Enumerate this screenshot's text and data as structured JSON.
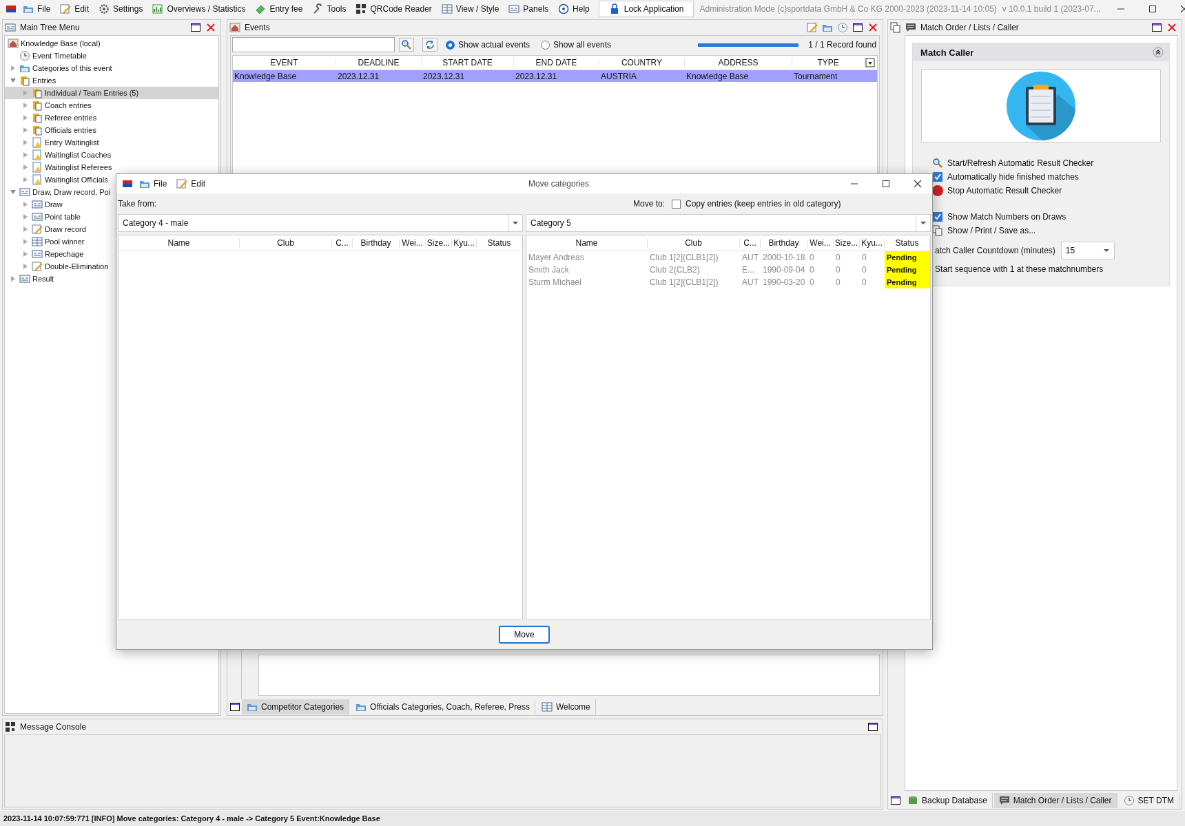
{
  "menubar": {
    "items": [
      {
        "label": "File"
      },
      {
        "label": "Edit"
      },
      {
        "label": "Settings"
      },
      {
        "label": "Overviews / Statistics"
      },
      {
        "label": "Entry fee"
      },
      {
        "label": "Tools"
      },
      {
        "label": "QRCode Reader"
      },
      {
        "label": "View / Style"
      },
      {
        "label": "Panels"
      },
      {
        "label": "Help"
      }
    ],
    "lock_button": "Lock Application",
    "mode_text": "Administration Mode (c)sportdata GmbH & Co KG 2000-2023 (2023-11-14 10:05)",
    "version_text": "v 10.0.1 build 1 (2023-07..."
  },
  "tree_panel": {
    "title": "Main Tree Menu",
    "items": [
      {
        "label": "Knowledge Base (local)",
        "selected": false,
        "children": [
          {
            "label": "Event Timetable",
            "selected": false
          },
          {
            "label": "Categories of this event",
            "expanded": false,
            "selected": false
          },
          {
            "label": "Entries",
            "expanded": true,
            "selected": false,
            "children": [
              {
                "label": "Individual / Team Entries (5)",
                "expanded": false,
                "selected": true
              },
              {
                "label": "Coach entries",
                "expanded": false,
                "selected": false
              },
              {
                "label": "Referee entries",
                "expanded": false,
                "selected": false
              },
              {
                "label": "Officials entries",
                "expanded": false,
                "selected": false
              },
              {
                "label": "Entry Waitinglist",
                "expanded": false,
                "selected": false
              },
              {
                "label": "Waitinglist Coaches",
                "expanded": false,
                "selected": false
              },
              {
                "label": "Waitinglist Referees",
                "expanded": false,
                "selected": false
              },
              {
                "label": "Waitinglist Officials",
                "expanded": false,
                "selected": false
              }
            ]
          },
          {
            "label": "Draw, Draw record, Poi",
            "expanded": true,
            "selected": false,
            "children": [
              {
                "label": "Draw",
                "expanded": false,
                "selected": false
              },
              {
                "label": "Point table",
                "expanded": false,
                "selected": false
              },
              {
                "label": "Draw record",
                "expanded": false,
                "selected": false
              },
              {
                "label": "Pool winner",
                "expanded": false,
                "selected": false
              },
              {
                "label": "Repechage",
                "expanded": false,
                "selected": false
              },
              {
                "label": "Double-Elimination",
                "expanded": false,
                "selected": false
              }
            ]
          },
          {
            "label": "Result",
            "expanded": false,
            "selected": false
          }
        ]
      }
    ]
  },
  "events_panel": {
    "title": "Events",
    "radios": [
      {
        "label": "Show actual events",
        "selected": true
      },
      {
        "label": "Show all events",
        "selected": false
      }
    ],
    "progress": {
      "level": 1
    },
    "record_count": "1 / 1 Record found",
    "table": {
      "columns": [
        "EVENT",
        "DEADLINE",
        "START DATE",
        "END DATE",
        "COUNTRY",
        "ADDRESS",
        "TYPE"
      ],
      "rows": [
        {
          "cells": [
            "Knowledge Base",
            "2023.12.31",
            "2023.12.31",
            "2023.12.31",
            "AUSTRIA",
            "Knowledge Base",
            "Tournament"
          ],
          "selected": true
        }
      ]
    },
    "tabs": [
      {
        "label": "Competitor Categories",
        "selected": true
      },
      {
        "label": "Officials Categories, Coach, Referee, Press",
        "selected": false
      },
      {
        "label": "Welcome",
        "selected": false
      }
    ]
  },
  "console": {
    "title": "Message Console"
  },
  "right_panel": {
    "title": "Match Order / Lists / Caller",
    "section": {
      "title": "Match Caller",
      "expanded": true
    },
    "actions_1": [
      {
        "kind": "action",
        "label": "Start/Refresh Automatic Result Checker"
      },
      {
        "kind": "check",
        "label": "Automatically hide finished matches",
        "checked": true
      },
      {
        "kind": "action",
        "label": "Stop Automatic Result Checker"
      }
    ],
    "actions_2": [
      {
        "kind": "check",
        "label": "Show Match Numbers on Draws",
        "checked": true
      },
      {
        "kind": "action",
        "label": "Show / Print / Save as..."
      }
    ],
    "countdown": {
      "label": "atch Caller Countdown (minutes)",
      "value": "15"
    },
    "sequence_label": "Start sequence with 1 at these matchnumbers",
    "tabs": [
      {
        "label": "Backup Database",
        "selected": false
      },
      {
        "label": "Match Order / Lists / Caller",
        "selected": true
      },
      {
        "label": "SET DTM",
        "selected": false
      }
    ]
  },
  "dialog": {
    "title": "Move categories",
    "menu": [
      "File",
      "Edit"
    ],
    "take_from_label": "Take from:",
    "move_to_label": "Move to:",
    "copy_checkbox": {
      "label": "Copy entries (keep entries in old category)",
      "checked": false
    },
    "left": {
      "category": "Category 4 - male",
      "columns": [
        "Name",
        "Club",
        "C...",
        "Birthday",
        "Wei...",
        "Size...",
        "Kyu...",
        "Status"
      ]
    },
    "right": {
      "category": "Category 5",
      "columns": [
        "Name",
        "Club",
        "C...",
        "Birthday",
        "Wei...",
        "Size...",
        "Kyu...",
        "Status"
      ],
      "rows": [
        {
          "cells": [
            "Mayer Andreas",
            "Club 1[2](CLB1[2])",
            "AUT",
            "2000-10-18",
            "0",
            "0",
            "0"
          ],
          "status": "Pending"
        },
        {
          "cells": [
            "Smith Jack",
            "Club 2(CLB2)",
            "E...",
            "1990-09-04",
            "0",
            "0",
            "0"
          ],
          "status": "Pending"
        },
        {
          "cells": [
            "Sturm Michael",
            "Club 1[2](CLB1[2])",
            "AUT",
            "1990-03-20",
            "0",
            "0",
            "0"
          ],
          "status": "Pending"
        }
      ]
    },
    "move_button": "Move"
  },
  "status_bar": "2023-11-14 10:07:59:771 [INFO] Move categories: Category 4 - male -> Category 5 Event:Knowledge Base"
}
